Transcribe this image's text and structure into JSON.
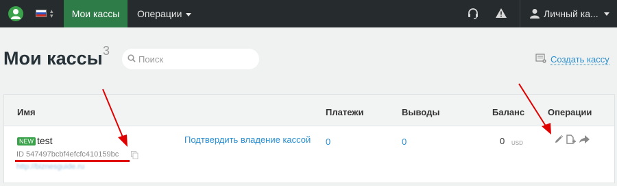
{
  "navbar": {
    "language": "ru",
    "active_tab": "Мои кассы",
    "operations_menu": "Операции",
    "user_menu": "Личный ка...",
    "icons": [
      "logo-icon",
      "flag-ru-icon",
      "headset-icon",
      "warning-icon",
      "user-icon"
    ]
  },
  "header": {
    "title": "Мои кассы",
    "count": "3",
    "search_placeholder": "Поиск",
    "create_link": "Создать кассу"
  },
  "table": {
    "columns": {
      "name": "Имя",
      "payments": "Платежи",
      "withdrawals": "Выводы",
      "balance": "Баланс",
      "operations": "Операции"
    },
    "rows": [
      {
        "badge": "NEW",
        "name": "test",
        "id": "ID 547497bcbf4efcfc410159bc",
        "url": "http://biznesguide.ru",
        "confirm_link": "Подтвердить владение кассой",
        "payments": "0",
        "withdrawals": "0",
        "balance": "0",
        "currency": "USD"
      }
    ]
  },
  "colors": {
    "navbar_bg": "#262b2e",
    "active_tab_bg": "#2e7d48",
    "link": "#2a8fd0",
    "badge_green": "#3aa24a",
    "annotation_red": "#e00000"
  }
}
